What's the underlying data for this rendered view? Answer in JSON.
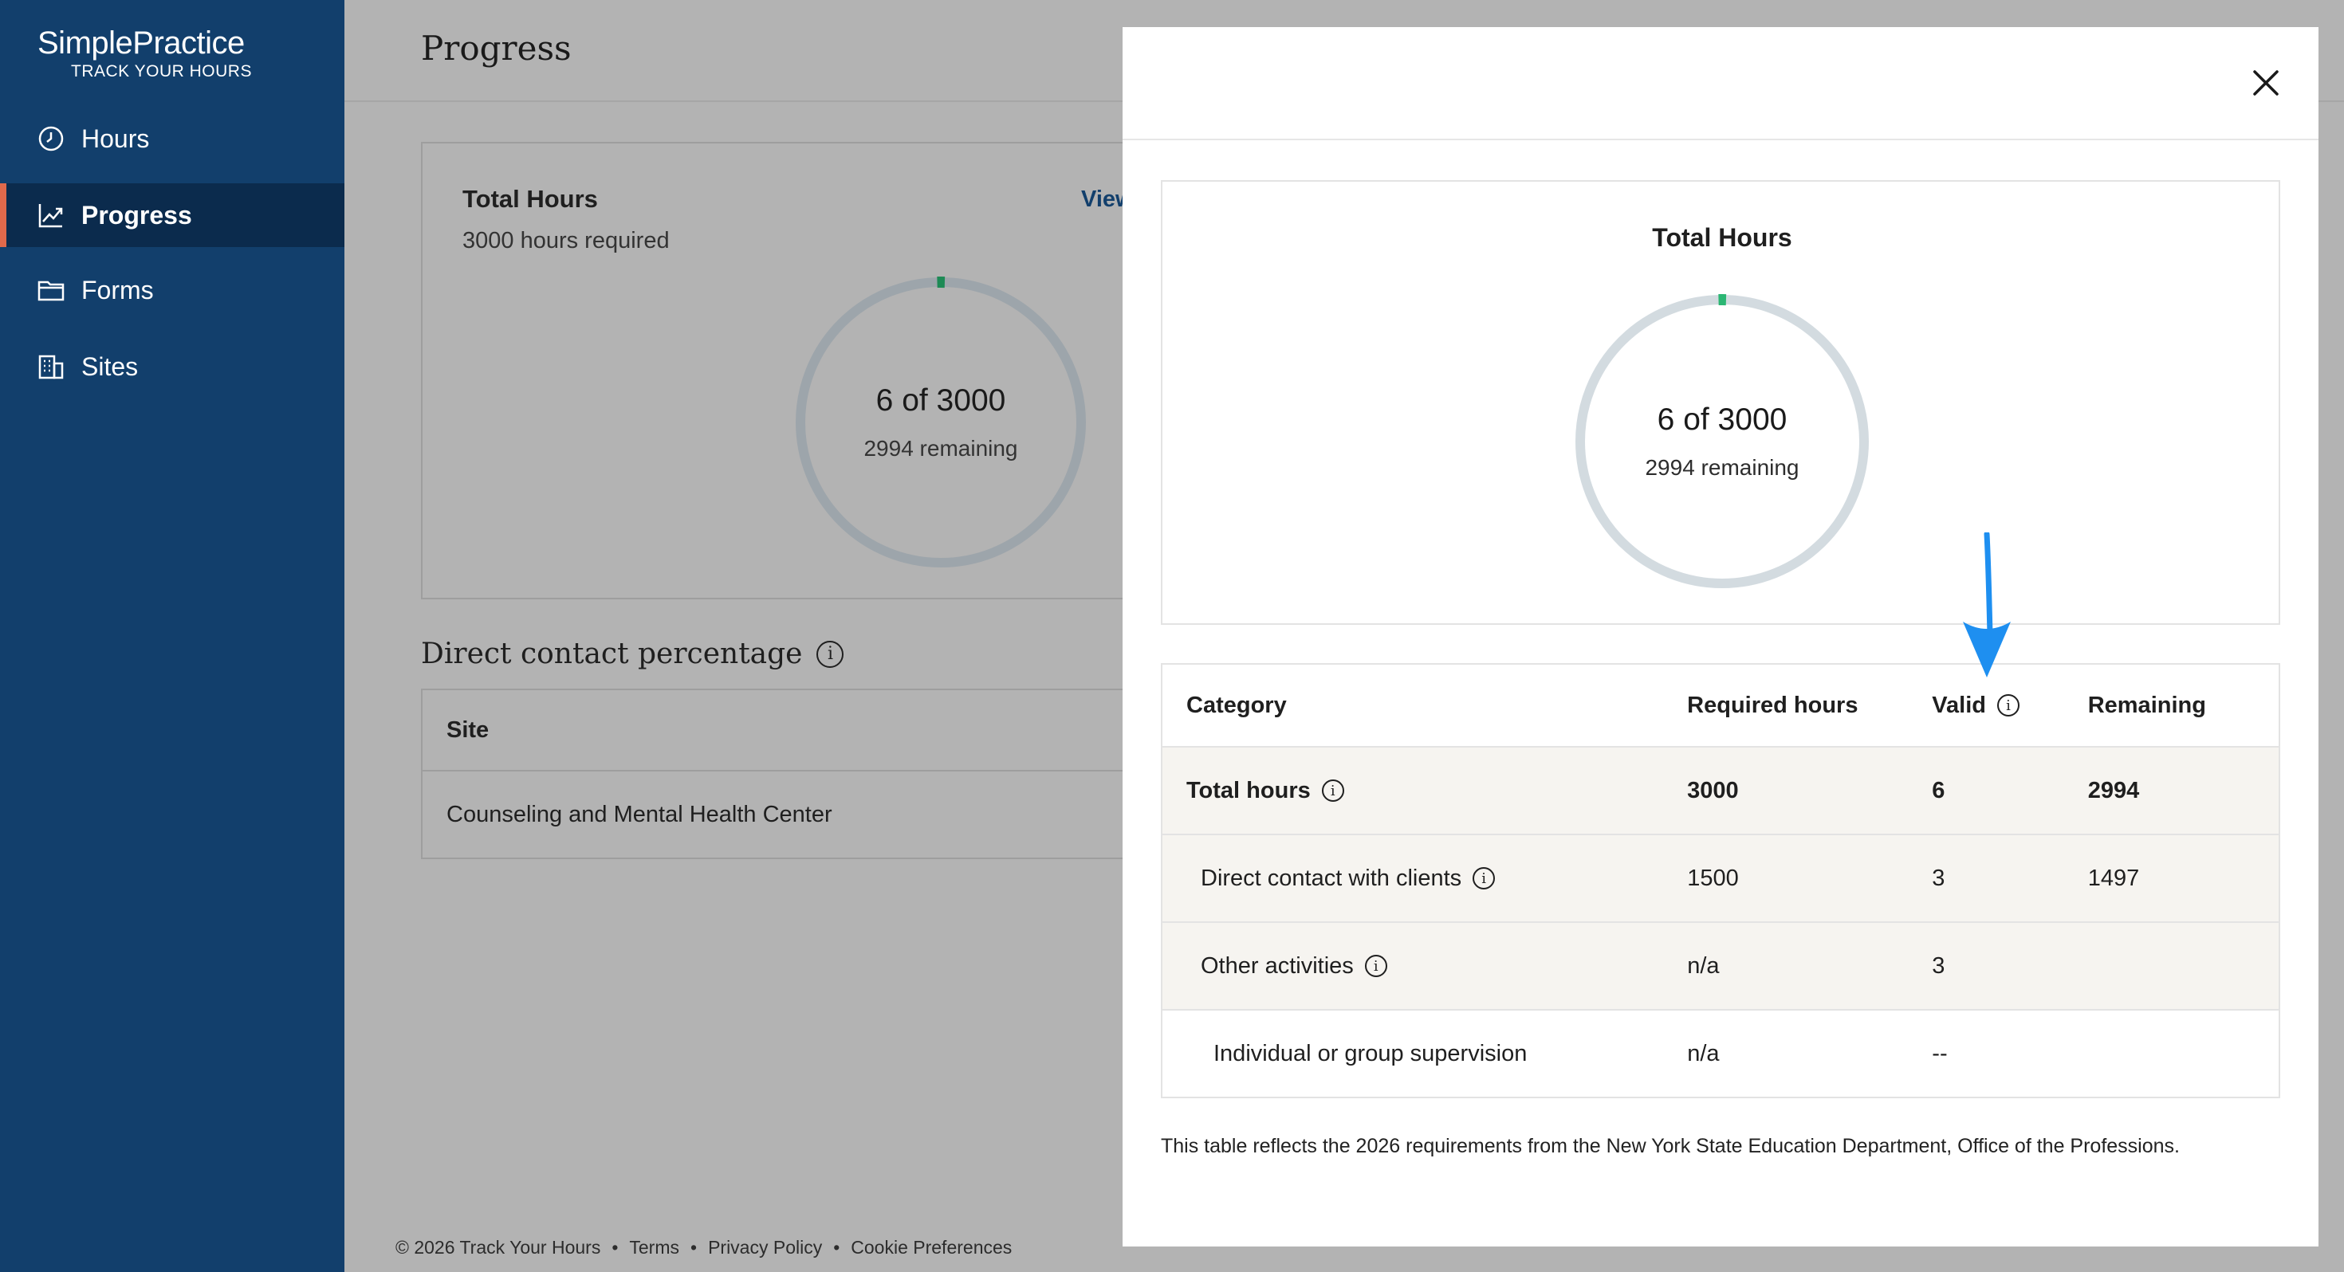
{
  "app": {
    "brand_name": "SimplePractice",
    "brand_sub": "TRACK YOUR HOURS"
  },
  "sidebar": {
    "items": [
      {
        "label": "Hours",
        "icon": "clock-icon",
        "active": false
      },
      {
        "label": "Progress",
        "icon": "trend-chart-icon",
        "active": true
      },
      {
        "label": "Forms",
        "icon": "folder-icon",
        "active": false
      },
      {
        "label": "Sites",
        "icon": "building-icon",
        "active": false
      }
    ]
  },
  "page": {
    "title": "Progress",
    "total_card": {
      "title": "Total Hours",
      "subtitle": "3000 hours required",
      "view_link": "View",
      "ring_main": "6 of 3000",
      "ring_sub": "2994 remaining",
      "progress_fraction": 0.002
    },
    "direct_contact": {
      "title": "Direct contact percentage",
      "column_header": "Site",
      "rows": [
        "Counseling and Mental Health Center"
      ]
    }
  },
  "footer": {
    "copyright": "© 2026 Track Your Hours",
    "separator": "•",
    "links": [
      "Terms",
      "Privacy Policy",
      "Cookie Preferences"
    ]
  },
  "modal": {
    "chart_title": "Total Hours",
    "ring_main": "6 of 3000",
    "ring_sub": "2994 remaining",
    "progress_fraction": 0.002,
    "table": {
      "headers": {
        "category": "Category",
        "required": "Required hours",
        "valid": "Valid",
        "remaining": "Remaining"
      },
      "rows": [
        {
          "category": "Total hours",
          "required": "3000",
          "valid": "6",
          "remaining": "2994"
        },
        {
          "category": "Direct contact with clients",
          "required": "1500",
          "valid": "3",
          "remaining": "1497"
        },
        {
          "category": "Other activities",
          "required": "n/a",
          "valid": "3",
          "remaining": ""
        },
        {
          "category": "Individual or group supervision",
          "required": "n/a",
          "valid": "--",
          "remaining": ""
        }
      ]
    },
    "note": "This table reflects the 2026 requirements from the New York State Education Department, Office of the Professions."
  },
  "colors": {
    "sidebar": "#123f6c",
    "sidebar_active": "#0b2b4d",
    "accent": "#e0694b",
    "progress_green": "#2bb673",
    "ring_track": "#d3dbe0",
    "annotation_arrow": "#1e8ff0"
  }
}
